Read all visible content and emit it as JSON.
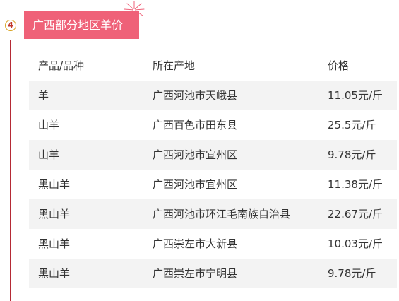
{
  "section": {
    "number": "4",
    "title": "广西部分地区羊价"
  },
  "table": {
    "headers": [
      "产品/品种",
      "所在产地",
      "价格"
    ],
    "rows": [
      [
        "羊",
        "广西河池市天峨县",
        "11.05元/斤"
      ],
      [
        "山羊",
        "广西百色市田东县",
        "25.5元/斤"
      ],
      [
        "山羊",
        "广西河池市宜州区",
        "9.78元/斤"
      ],
      [
        "黑山羊",
        "广西河池市宜州区",
        "11.38元/斤"
      ],
      [
        "黑山羊",
        "广西河池市环江毛南族自治县",
        "22.67元/斤"
      ],
      [
        "黑山羊",
        "广西崇左市大新县",
        "10.03元/斤"
      ],
      [
        "黑山羊",
        "广西崇左市宁明县",
        "9.78元/斤"
      ]
    ]
  },
  "colors": {
    "title_bg": "#ef6178",
    "accent_line": "#b52a35",
    "badge_border": "#d8a21f",
    "row_shade": "#f3f3f3"
  }
}
